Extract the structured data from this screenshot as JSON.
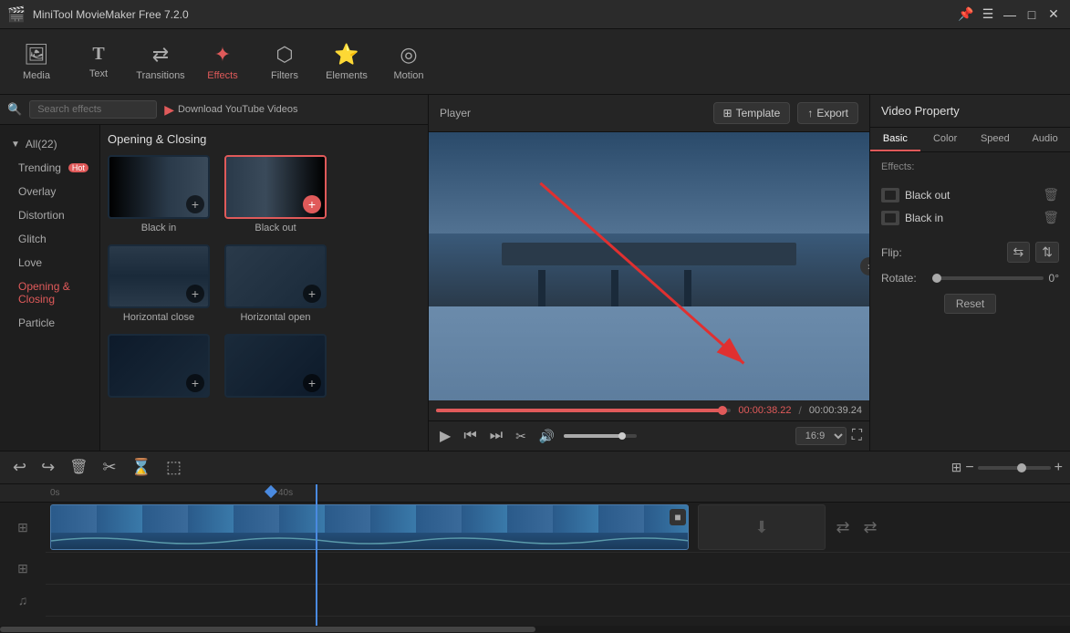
{
  "app": {
    "title": "MiniTool MovieMaker Free 7.2.0",
    "icon": "🎬"
  },
  "title_controls": {
    "pin": "📌",
    "menu": "☰",
    "minimize": "—",
    "restore": "□",
    "close": "✕"
  },
  "toolbar": {
    "items": [
      {
        "id": "media",
        "label": "Media",
        "icon": "🖼"
      },
      {
        "id": "text",
        "label": "Text",
        "icon": "T"
      },
      {
        "id": "transitions",
        "label": "Transitions",
        "icon": "⇄"
      },
      {
        "id": "effects",
        "label": "Effects",
        "icon": "✦",
        "active": true
      },
      {
        "id": "filters",
        "label": "Filters",
        "icon": "⬡"
      },
      {
        "id": "elements",
        "label": "Elements",
        "icon": "⭐"
      },
      {
        "id": "motion",
        "label": "Motion",
        "icon": "◎"
      }
    ]
  },
  "left_panel": {
    "search_placeholder": "Search effects",
    "yt_download": "Download YouTube Videos",
    "categories": [
      {
        "id": "all",
        "label": "All(22)",
        "active": true,
        "arrow": true
      },
      {
        "id": "trending",
        "label": "Trending",
        "badge": "Hot"
      },
      {
        "id": "overlay",
        "label": "Overlay"
      },
      {
        "id": "distortion",
        "label": "Distortion"
      },
      {
        "id": "glitch",
        "label": "Glitch"
      },
      {
        "id": "love",
        "label": "Love"
      },
      {
        "id": "opening-closing",
        "label": "Opening & Closing",
        "active_section": true
      },
      {
        "id": "particle",
        "label": "Particle"
      }
    ],
    "section_title": "Opening & Closing",
    "effects": [
      {
        "id": "black-in",
        "name": "Black in",
        "type": "black-in"
      },
      {
        "id": "black-out",
        "name": "Black out",
        "type": "black-out",
        "selected": true,
        "has_plus": true
      },
      {
        "id": "horizontal-close",
        "name": "Horizontal close",
        "type": "h-close"
      },
      {
        "id": "horizontal-open",
        "name": "Horizontal open",
        "type": "h-open"
      },
      {
        "id": "effect-5",
        "name": "",
        "type": "dark"
      },
      {
        "id": "effect-6",
        "name": "",
        "type": "dark"
      }
    ]
  },
  "player": {
    "title": "Player",
    "template_btn": "Template",
    "export_btn": "Export",
    "time_current": "00:00:38.22",
    "time_total": "00:00:39.24",
    "progress_pct": 97,
    "controls": {
      "play": "▶",
      "skip_back": "⏮",
      "skip_forward": "⏭",
      "cut": "✂",
      "volume": "🔊"
    },
    "ratio": "16:9",
    "fullscreen": "⛶"
  },
  "video_property": {
    "title": "Video Property",
    "tabs": [
      "Basic",
      "Color",
      "Speed",
      "Audio"
    ],
    "active_tab": "Basic",
    "effects_label": "Effects:",
    "effects": [
      {
        "name": "Black out",
        "id": "black-out-prop"
      },
      {
        "name": "Black in",
        "id": "black-in-prop"
      }
    ],
    "flip_label": "Flip:",
    "rotate_label": "Rotate:",
    "rotate_value": "0°",
    "reset_label": "Reset"
  },
  "timeline": {
    "toolbar_btns": [
      "↩",
      "↪",
      "🗑",
      "✂",
      "⌛",
      "⬚"
    ],
    "time_marker": "0s",
    "time_marker2": "40s",
    "zoom_plus": "+",
    "zoom_minus": "−",
    "tracks": [
      {
        "type": "video",
        "icon": "⊞"
      },
      {
        "type": "audio",
        "icon": "♪"
      },
      {
        "type": "music",
        "icon": "♫"
      }
    ],
    "empty_clips": [
      "⬇",
      "⇄",
      "⇄"
    ]
  }
}
